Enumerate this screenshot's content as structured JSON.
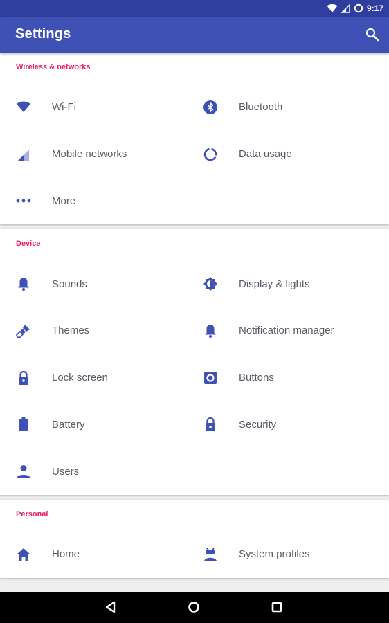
{
  "status_bar": {
    "time": "9:17"
  },
  "app_bar": {
    "title": "Settings",
    "search_icon": "search-icon"
  },
  "colors": {
    "primary": "#3f51b5",
    "primary_dark": "#303f9f",
    "accent": "#e91e63",
    "icon": "#3f51b5"
  },
  "sections": [
    {
      "title": "Wireless & networks",
      "items": [
        {
          "label": "Wi-Fi",
          "icon": "wifi-icon"
        },
        {
          "label": "Bluetooth",
          "icon": "bluetooth-icon"
        },
        {
          "label": "Mobile networks",
          "icon": "signal-icon"
        },
        {
          "label": "Data usage",
          "icon": "data-usage-icon"
        },
        {
          "label": "More",
          "icon": "more-icon"
        }
      ]
    },
    {
      "title": "Device",
      "items": [
        {
          "label": "Sounds",
          "icon": "bell-icon"
        },
        {
          "label": "Display & lights",
          "icon": "brightness-icon"
        },
        {
          "label": "Themes",
          "icon": "brush-icon"
        },
        {
          "label": "Notification manager",
          "icon": "bell-icon"
        },
        {
          "label": "Lock screen",
          "icon": "lock-icon"
        },
        {
          "label": "Buttons",
          "icon": "buttons-icon"
        },
        {
          "label": "Battery",
          "icon": "battery-icon"
        },
        {
          "label": "Security",
          "icon": "lock-icon"
        },
        {
          "label": "Users",
          "icon": "user-icon"
        }
      ]
    },
    {
      "title": "Personal",
      "items": [
        {
          "label": "Home",
          "icon": "home-icon"
        },
        {
          "label": "System profiles",
          "icon": "profile-icon"
        }
      ]
    }
  ],
  "nav_bar": {
    "back_icon": "back-icon",
    "home_icon": "home-circle-icon",
    "recents_icon": "recents-icon"
  }
}
